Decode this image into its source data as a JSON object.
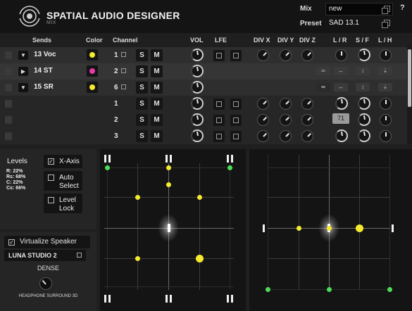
{
  "app": {
    "title": "SPATIAL AUDIO DESIGNER",
    "subtitle": "MIX",
    "help": "?"
  },
  "header": {
    "mix_label": "Mix",
    "mix_value": "new",
    "preset_label": "Preset",
    "preset_value": "SAD 13.1"
  },
  "columns": {
    "sends": "Sends",
    "color": "Color",
    "channel": "Channel",
    "vol": "VOL",
    "lfe": "LFE",
    "divx": "DIV X",
    "divy": "DIV Y",
    "divz": "DIV Z",
    "lr": "L / R",
    "sf": "S / F",
    "lh": "L / H"
  },
  "sends": [
    {
      "name": "13 Voc",
      "color": "#f5ea2e",
      "channels": "1",
      "expanded": true
    },
    {
      "name": "14 ST",
      "color": "#e83aa8",
      "channels": "2",
      "expanded": false
    },
    {
      "name": "15 SR",
      "color": "#f5ea2e",
      "channels": "6",
      "expanded": true
    }
  ],
  "channel_rows": [
    {
      "num": "1"
    },
    {
      "num": "2"
    },
    {
      "num": "3"
    }
  ],
  "buttons": {
    "solo": "S",
    "mute": "M"
  },
  "tooltip": "71",
  "levels": {
    "title": "Levels",
    "values": [
      "R: 22%",
      "Rs: 68%",
      "C: 22%",
      "Cs: 66%"
    ]
  },
  "options": {
    "x_axis": "X-Axis",
    "auto_select": [
      "Auto",
      "Select"
    ],
    "level_lock": [
      "Level",
      "Lock"
    ]
  },
  "virtualize": {
    "label": "Virtualize Speaker",
    "speaker": "LUNA STUDIO 2",
    "mode": "DENSE",
    "footer": "HEADPHONE SURROUND 3D"
  },
  "colors": {
    "accent_yellow": "#f5ea2e",
    "speaker_green": "#4cdc56",
    "send_pink": "#e83aa8"
  },
  "icons": [
    "logo-icon",
    "popup-icon",
    "lock-icon",
    "expand-arrow-icon",
    "collapse-arrow-icon",
    "link-icon",
    "knob-icon",
    "speaker-dot-icon",
    "head-marker-icon"
  ]
}
